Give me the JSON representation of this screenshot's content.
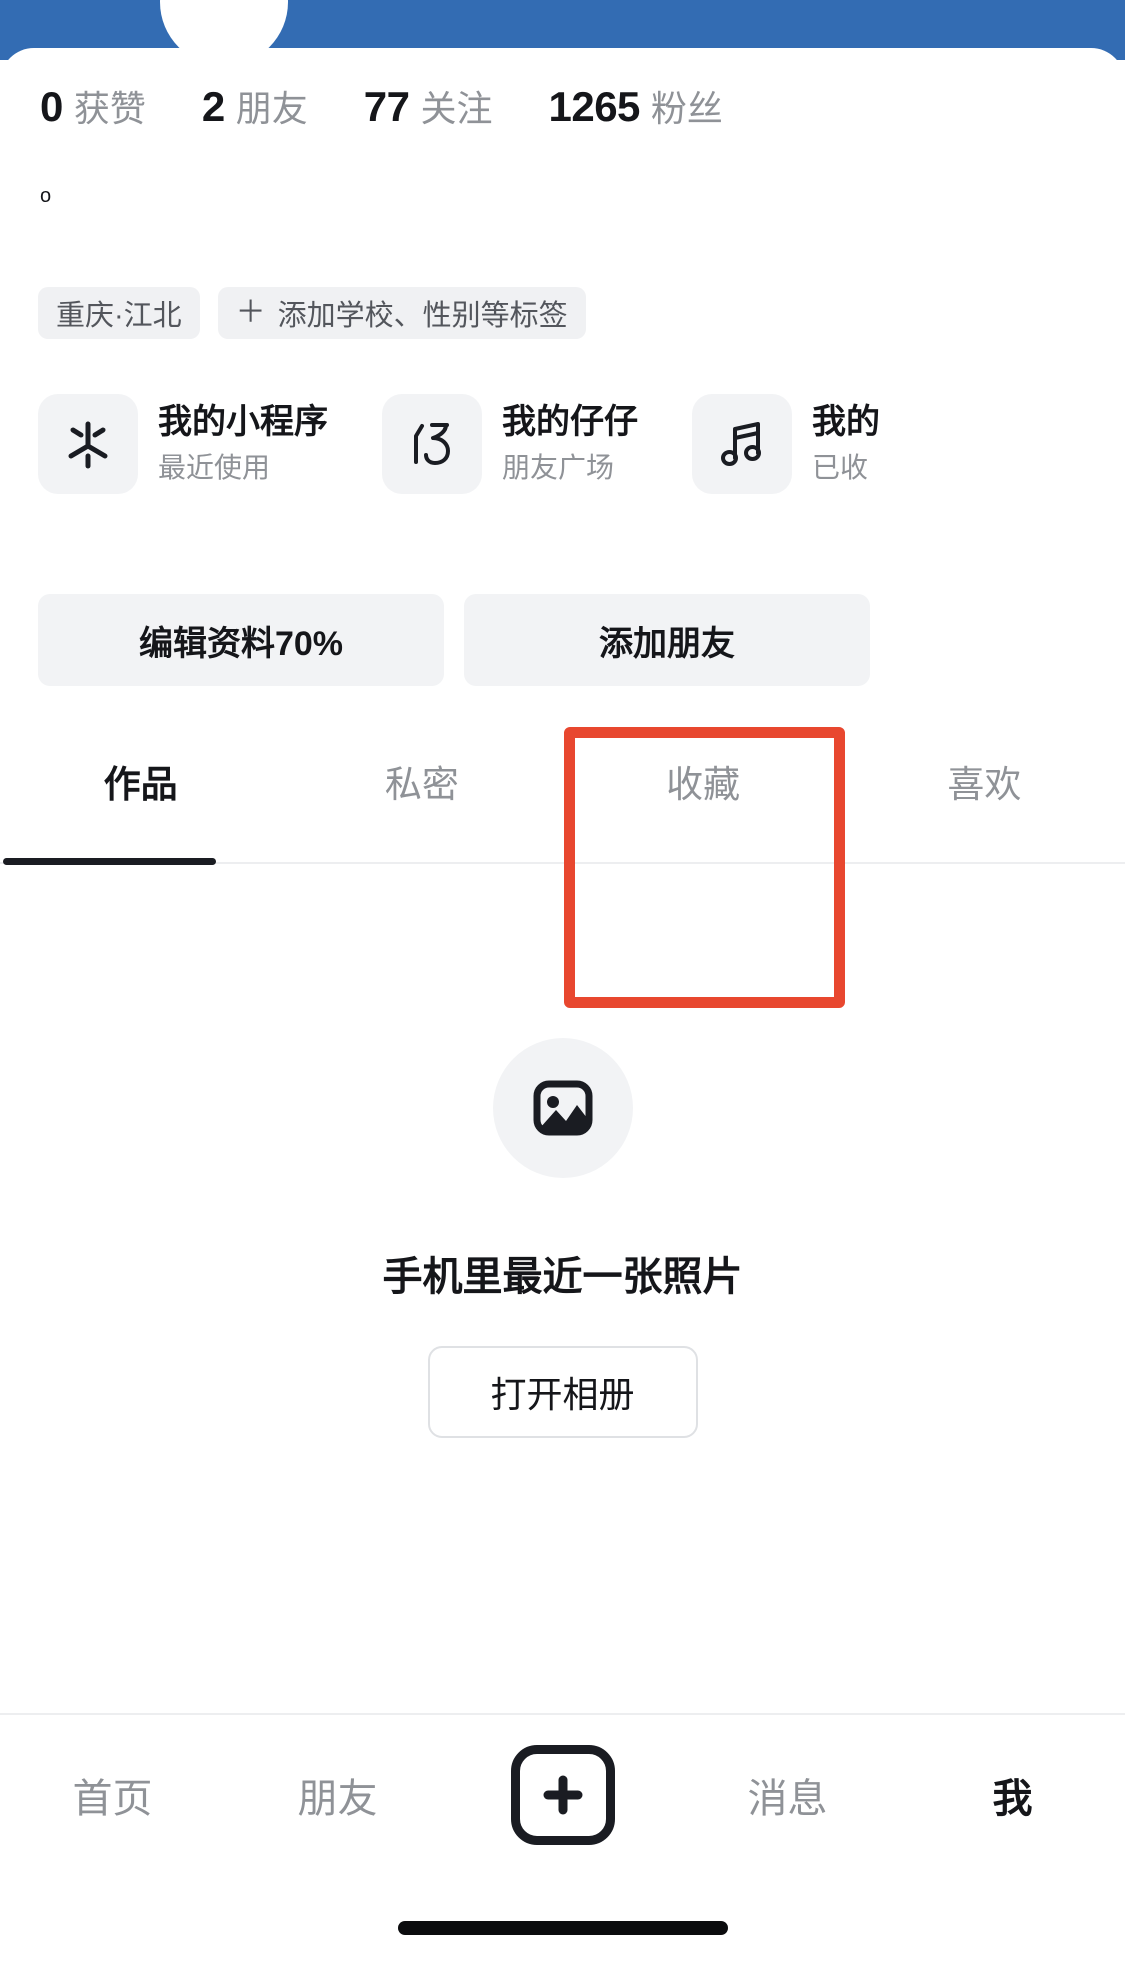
{
  "theme": {
    "brand_blue": "#336CB3",
    "highlight_red": "#E8472F",
    "text_primary": "#15161A",
    "text_secondary": "#8F9297",
    "chip_bg": "#F2F3F5"
  },
  "profile": {
    "stats": [
      {
        "value": "0",
        "label": "获赞"
      },
      {
        "value": "2",
        "label": "朋友"
      },
      {
        "value": "77",
        "label": "关注"
      },
      {
        "value": "1265",
        "label": "粉丝"
      }
    ],
    "signature": "o",
    "tags": [
      {
        "label": "重庆·江北",
        "has_plus": false
      },
      {
        "label": "添加学校、性别等标签",
        "has_plus": true,
        "plus": "＋"
      }
    ]
  },
  "cards": [
    {
      "icon": "miniprogram-icon",
      "title": "我的小程序",
      "sub": "最近使用"
    },
    {
      "icon": "zaizai-icon",
      "title": "我的仔仔",
      "sub": "朋友广场"
    },
    {
      "icon": "music-note-icon",
      "title": "我的",
      "sub": "已收"
    }
  ],
  "actions": [
    {
      "label": "编辑资料70%"
    },
    {
      "label": "添加朋友"
    }
  ],
  "tabs": [
    {
      "label": "作品",
      "active": true
    },
    {
      "label": "私密",
      "active": false
    },
    {
      "label": "收藏",
      "active": false,
      "highlighted": true
    },
    {
      "label": "喜欢",
      "active": false
    }
  ],
  "empty_state": {
    "icon": "photo-icon",
    "title": "手机里最近一张照片",
    "button_label": "打开相册"
  },
  "bottom_nav": [
    {
      "label": "首页",
      "active": false
    },
    {
      "label": "朋友",
      "active": false
    },
    {
      "label": "",
      "active": false,
      "icon": "plus-icon"
    },
    {
      "label": "消息",
      "active": false
    },
    {
      "label": "我",
      "active": true
    }
  ]
}
